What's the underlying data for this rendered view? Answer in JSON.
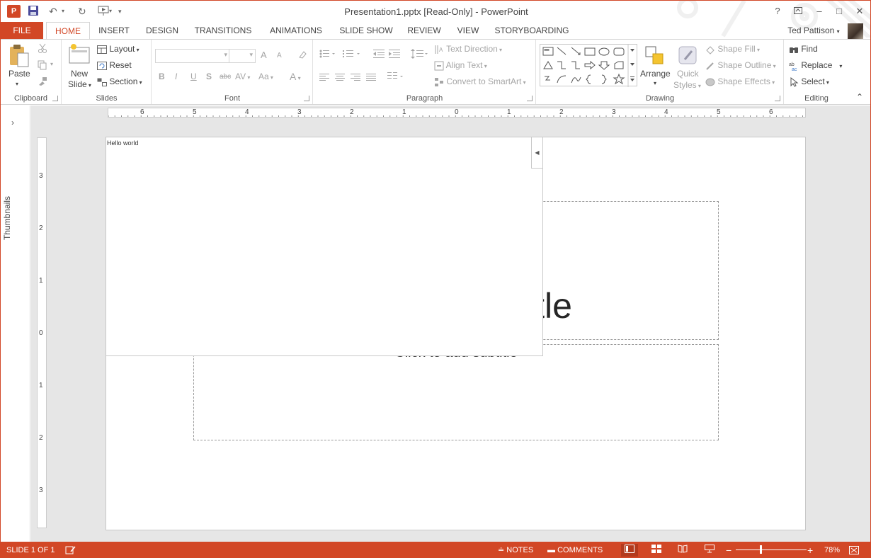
{
  "titlebar": {
    "app_logo": "P",
    "title": "Presentation1.pptx [Read-Only] - PowerPoint",
    "help": "?",
    "ribbon_display_icon": "ribbon-display-icon",
    "minimize": "–",
    "restore": "□",
    "close": "✕"
  },
  "tabs": {
    "file": "FILE",
    "items": [
      "HOME",
      "INSERT",
      "DESIGN",
      "TRANSITIONS",
      "ANIMATIONS",
      "SLIDE SHOW",
      "REVIEW",
      "VIEW",
      "STORYBOARDING"
    ],
    "active": "HOME",
    "user": "Ted Pattison"
  },
  "ribbon": {
    "clipboard": {
      "label": "Clipboard",
      "paste": "Paste"
    },
    "slides": {
      "label": "Slides",
      "new_slide_1": "New",
      "new_slide_2": "Slide",
      "layout": "Layout",
      "reset": "Reset",
      "section": "Section"
    },
    "font": {
      "label": "Font",
      "bold": "B",
      "italic": "I",
      "underline": "U",
      "shadow": "S",
      "strike": "abc",
      "spacing": "AV",
      "case": "Aa",
      "grow": "A",
      "shrink": "A",
      "color": "A"
    },
    "paragraph": {
      "label": "Paragraph",
      "text_direction": "Text Direction",
      "align_text": "Align Text",
      "convert_smartart": "Convert to SmartArt"
    },
    "drawing": {
      "label": "Drawing",
      "arrange": "Arrange",
      "quick_styles_1": "Quick",
      "quick_styles_2": "Styles",
      "shape_fill": "Shape Fill",
      "shape_outline": "Shape Outline",
      "shape_effects": "Shape Effects"
    },
    "editing": {
      "label": "Editing",
      "find": "Find",
      "replace": "Replace",
      "select": "Select"
    }
  },
  "left_pane": {
    "label": "Thumbnails"
  },
  "rulers": {
    "horizontal": [
      "6",
      "5",
      "4",
      "3",
      "2",
      "1",
      "0",
      "1",
      "2",
      "3",
      "4",
      "5",
      "6"
    ],
    "vertical": [
      "3",
      "2",
      "1",
      "0",
      "1",
      "2",
      "3"
    ]
  },
  "slide": {
    "title_placeholder": "Click to add title",
    "title_visible": "itle",
    "subtitle_placeholder": "Click to add subtitle"
  },
  "popup": {
    "text": "Hello world"
  },
  "statusbar": {
    "slide_info": "SLIDE 1 OF 1",
    "notes": "NOTES",
    "comments": "COMMENTS",
    "zoom_minus": "−",
    "zoom_plus": "+",
    "zoom": "78%",
    "zoom_fraction": 0.35
  },
  "colors": {
    "accent": "#D24726",
    "ribbon_bg": "#FFFFFF",
    "workspace_bg": "#E6E6E6"
  }
}
